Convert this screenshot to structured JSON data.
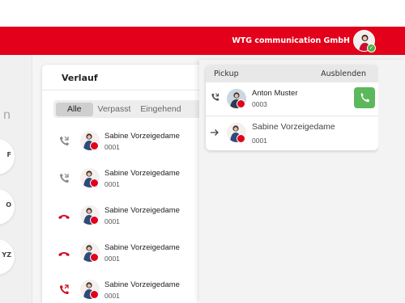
{
  "header": {
    "company": "WTG communication GmbH",
    "accent_color": "#e2001a",
    "status_color": "#4cae3f"
  },
  "left_rail": {
    "partial_letter": "n",
    "buttons": [
      {
        "label": "F"
      },
      {
        "label": "O"
      },
      {
        "label": "YZ"
      }
    ]
  },
  "history": {
    "title": "Verlauf",
    "tabs": [
      "Alle",
      "Verpasst",
      "Eingehend"
    ],
    "active_tab": "Alle",
    "rows": [
      {
        "name": "Sabine Vorzeigedame",
        "number": "0001",
        "icon": "incoming-call-icon"
      },
      {
        "name": "Sabine Vorzeigedame",
        "number": "0001",
        "icon": "incoming-call-icon"
      },
      {
        "name": "Sabine Vorzeigedame",
        "number": "0001",
        "icon": "hangup-icon"
      },
      {
        "name": "Sabine Vorzeigedame",
        "number": "0001",
        "icon": "hangup-icon"
      },
      {
        "name": "Sabine Vorzeigedame",
        "number": "0001",
        "icon": "missed-call-icon"
      }
    ]
  },
  "pickup": {
    "title": "Pickup",
    "hide_label": "Ausblenden",
    "entries": [
      {
        "name": "Anton Muster",
        "number": "0003",
        "icon": "incoming-call-icon"
      },
      {
        "name": "Sabine Vorzeigedame",
        "number": "0001",
        "icon": "forward-arrow-icon"
      }
    ]
  }
}
